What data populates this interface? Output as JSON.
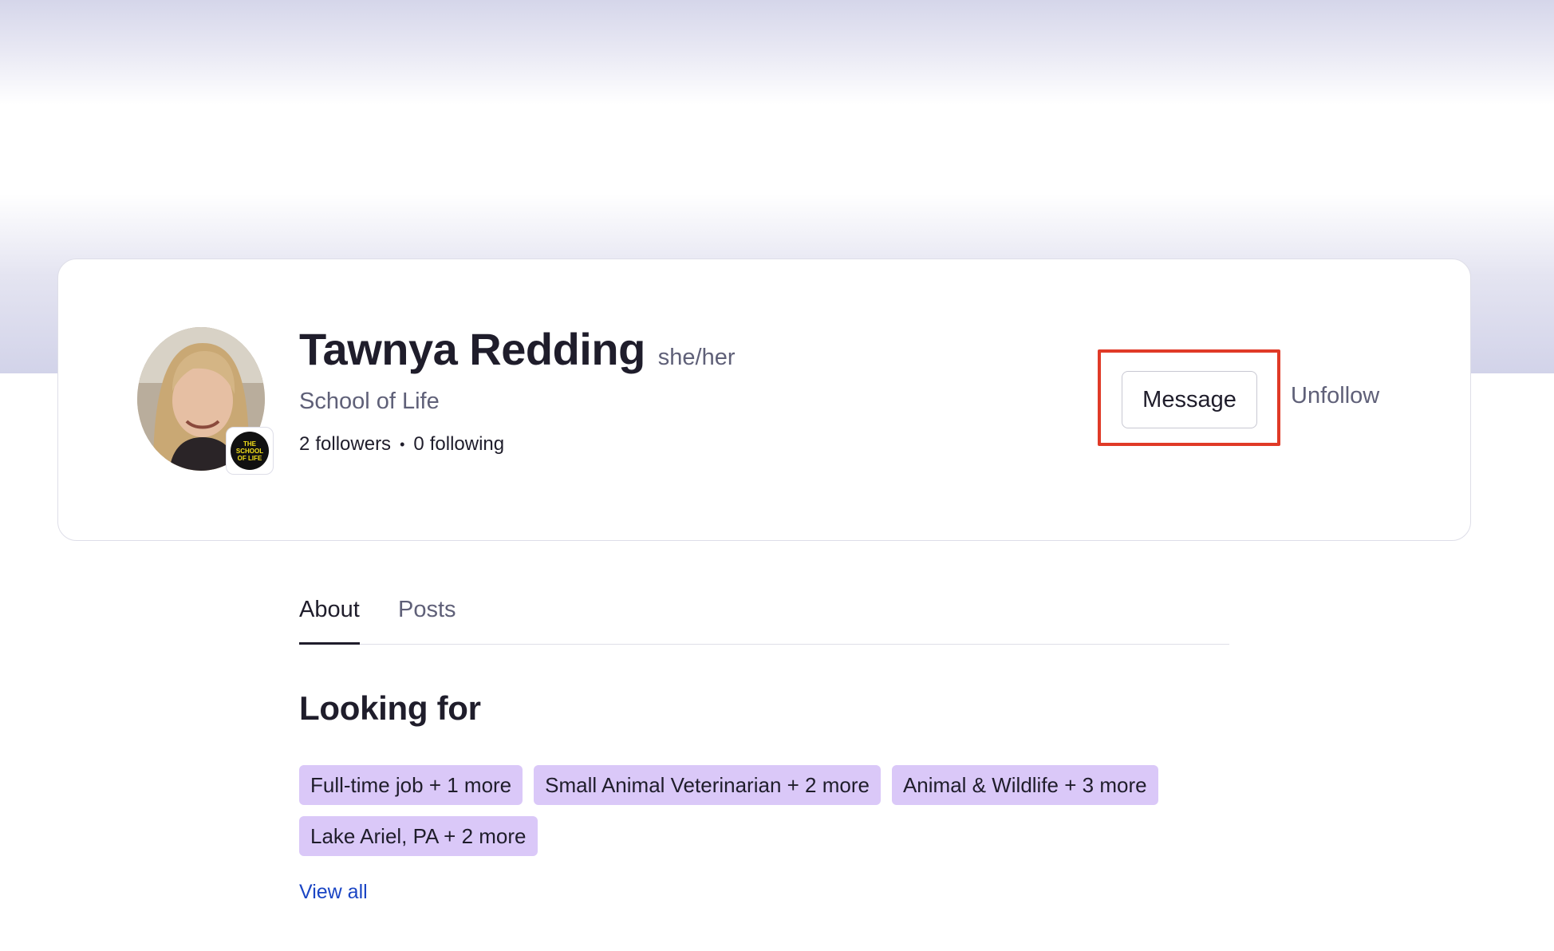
{
  "profile": {
    "name": "Tawnya Redding",
    "pronouns": "she/her",
    "school": "School of Life",
    "followers_count": "2",
    "followers_label": "followers",
    "separator": "•",
    "following_count": "0",
    "following_label": "following",
    "school_badge_text": "THE SCHOOL OF LIFE"
  },
  "actions": {
    "message_label": "Message",
    "unfollow_label": "Unfollow"
  },
  "tabs": [
    {
      "label": "About",
      "active": true
    },
    {
      "label": "Posts",
      "active": false
    }
  ],
  "looking_for": {
    "title": "Looking for",
    "chips": [
      "Full-time job + 1 more",
      "Small Animal Veterinarian + 2 more",
      "Animal & Wildlife + 3 more",
      "Lake Ariel, PA + 2 more"
    ],
    "view_all_label": "View all"
  },
  "colors": {
    "highlight": "#e03a27",
    "chip_bg": "#dac8f8",
    "link": "#1a45c4",
    "muted_text": "#5f6078"
  }
}
